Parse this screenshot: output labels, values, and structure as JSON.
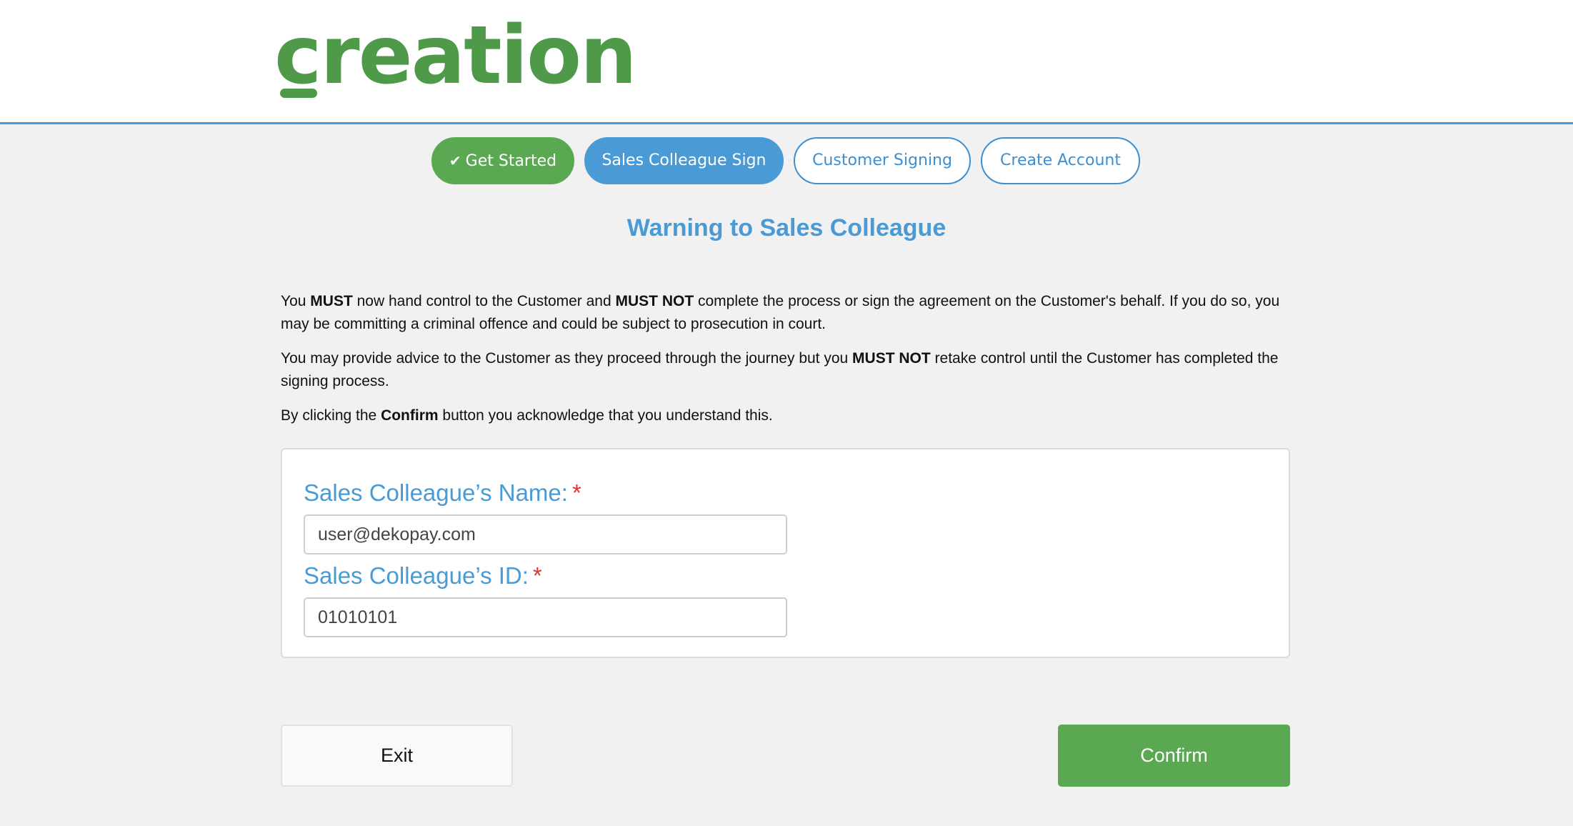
{
  "brand": {
    "logo_text": "creation"
  },
  "steps": [
    {
      "label": "Get Started",
      "state": "done",
      "icon": "check-icon"
    },
    {
      "label": "Sales Colleague Sign",
      "state": "active"
    },
    {
      "label": "Customer Signing",
      "state": "pending"
    },
    {
      "label": "Create Account",
      "state": "pending"
    }
  ],
  "warning": {
    "title": "Warning to Sales Colleague",
    "p1": {
      "t1": "You ",
      "b1": "MUST",
      "t2": " now hand control to the Customer and ",
      "b2": "MUST NOT",
      "t3": " complete the process or sign the agreement on the Customer's behalf. If you do so, you may be committing a criminal offence and could be subject to prosecution in court."
    },
    "p2": {
      "t1": "You may provide advice to the Customer as they proceed through the journey but you ",
      "b1": "MUST NOT",
      "t2": " retake control until the Customer has completed the signing process."
    },
    "p3": {
      "t1": "By clicking the ",
      "b1": "Confirm",
      "t2": " button you acknowledge that you understand this."
    }
  },
  "form": {
    "name_label": "Sales Colleague’s Name:",
    "name_value": "user@dekopay.com",
    "id_label": "Sales Colleague’s ID:",
    "id_value": "01010101",
    "required_marker": "*"
  },
  "actions": {
    "exit_label": "Exit",
    "confirm_label": "Confirm"
  },
  "colors": {
    "brand_green": "#4e9a48",
    "accent_blue": "#4a9bd5",
    "button_green": "#5aa952",
    "required_red": "#e0332f"
  }
}
